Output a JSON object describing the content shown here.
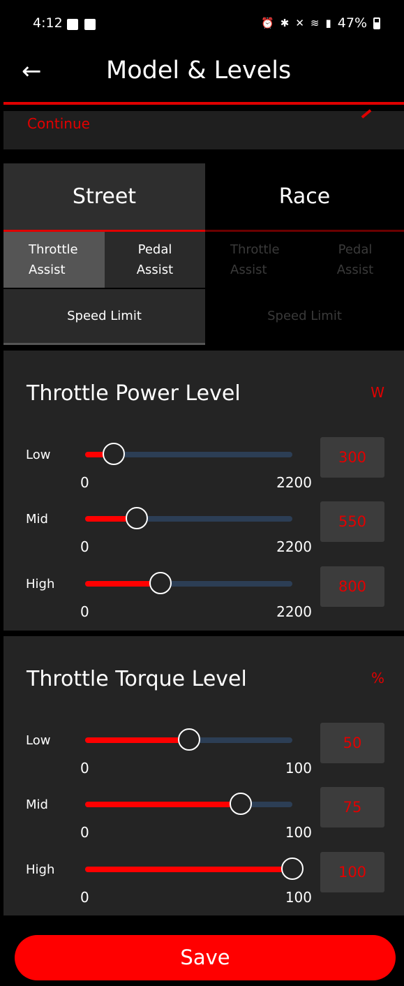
{
  "status_bar": {
    "time": "4:12",
    "battery": "47%"
  },
  "header": {
    "back_icon": "←",
    "title": "Model & Levels"
  },
  "continue_link": "Continue",
  "mode_tabs": [
    {
      "label": "Street",
      "active": true
    },
    {
      "label": "Race",
      "active": false
    }
  ],
  "sub_tabs": [
    {
      "line1": "Throttle",
      "line2": "Assist"
    },
    {
      "line1": "Pedal",
      "line2": "Assist"
    },
    {
      "line1": "Throttle",
      "line2": "Assist"
    },
    {
      "line1": "Pedal",
      "line2": "Assist"
    }
  ],
  "speed_tabs": [
    "Speed Limit",
    "Speed Limit"
  ],
  "power": {
    "title": "Throttle Power Level",
    "unit": "W",
    "rows": [
      {
        "label": "Low",
        "min": "0",
        "max": "2200",
        "value": "300"
      },
      {
        "label": "Mid",
        "min": "0",
        "max": "2200",
        "value": "550"
      },
      {
        "label": "High",
        "min": "0",
        "max": "2200",
        "value": "800"
      }
    ]
  },
  "torque": {
    "title": "Throttle Torque Level",
    "unit": "%",
    "rows": [
      {
        "label": "Low",
        "min": "0",
        "max": "100",
        "value": "50"
      },
      {
        "label": "Mid",
        "min": "0",
        "max": "100",
        "value": "75"
      },
      {
        "label": "High",
        "min": "0",
        "max": "100",
        "value": "100"
      }
    ]
  },
  "save_label": "Save",
  "colors": {
    "accent": "#ff0000",
    "track": "#2c3e55",
    "card": "#242424"
  }
}
